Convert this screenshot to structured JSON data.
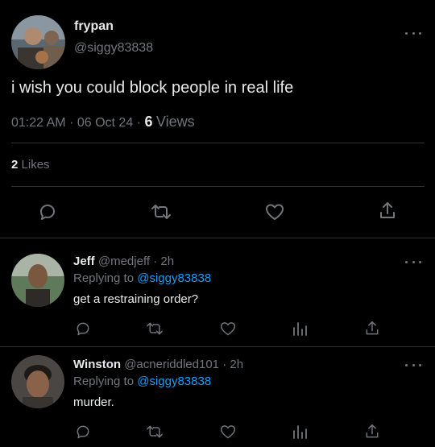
{
  "main_tweet": {
    "display_name": "frypan",
    "handle": "@siggy83838",
    "text": "i wish you could block people in real life",
    "time": "01:22 AM",
    "dot1": "·",
    "date": "06 Oct 24",
    "dot2": "·",
    "views_count": "6",
    "views_label": "Views",
    "likes_count": "2",
    "likes_label": "Likes"
  },
  "replies": [
    {
      "display_name": "Jeff",
      "handle": "@medjeff",
      "separator": "·",
      "age": "2h",
      "replying_prefix": "Replying to",
      "replying_handle": "@siggy83838",
      "text": "get a restraining order?"
    },
    {
      "display_name": "Winston",
      "handle": "@acneriddled101",
      "separator": "·",
      "age": "2h",
      "replying_prefix": "Replying to",
      "replying_handle": "@siggy83838",
      "text": "murder."
    }
  ],
  "icons": {
    "action_bar": [
      "reply-icon",
      "retweet-icon",
      "like-icon",
      "share-icon"
    ],
    "reply_bar": [
      "reply-icon",
      "retweet-icon",
      "like-icon",
      "analytics-icon",
      "share-icon"
    ],
    "more": "more-options-icon"
  },
  "colors": {
    "background": "#000000",
    "text": "#e7e9ea",
    "muted": "#71767b",
    "accent": "#1d9bf0",
    "divider": "#2f3336"
  }
}
